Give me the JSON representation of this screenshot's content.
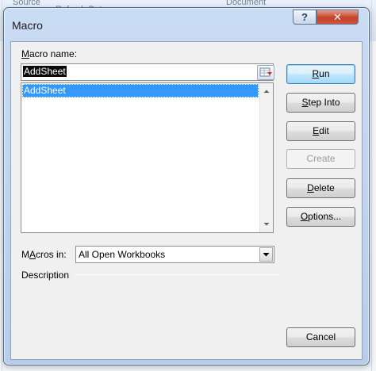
{
  "background": {
    "ribbon_texts": [
      "Source",
      "Refresh Data",
      "Document"
    ]
  },
  "window": {
    "title": "Macro",
    "help_button": "?",
    "close_button": "✕"
  },
  "macro_name": {
    "label_prefix": "",
    "label_underlined": "M",
    "label_rest": "acro name:",
    "value": "AddSheet"
  },
  "macro_list": {
    "items": [
      "AddSheet"
    ],
    "selected_index": 0
  },
  "macros_in": {
    "label_underlined": "A",
    "label_prefix": "M",
    "label_rest": "cros in:",
    "value": "All Open Workbooks"
  },
  "description": {
    "label": "Description"
  },
  "buttons": {
    "run": {
      "pre": "",
      "u": "R",
      "post": "un"
    },
    "step_into": {
      "pre": "",
      "u": "S",
      "post": "tep Into"
    },
    "edit": {
      "pre": "",
      "u": "E",
      "post": "dit"
    },
    "create": {
      "pre": "",
      "u": "C",
      "post": "reate"
    },
    "delete": {
      "pre": "",
      "u": "D",
      "post": "elete"
    },
    "options": {
      "pre": "",
      "u": "O",
      "post": "ptions..."
    },
    "cancel": {
      "label": "Cancel"
    }
  },
  "colors": {
    "selection": "#3399ff",
    "close_red": "#c2412a",
    "default_button": "#bee6fd"
  }
}
